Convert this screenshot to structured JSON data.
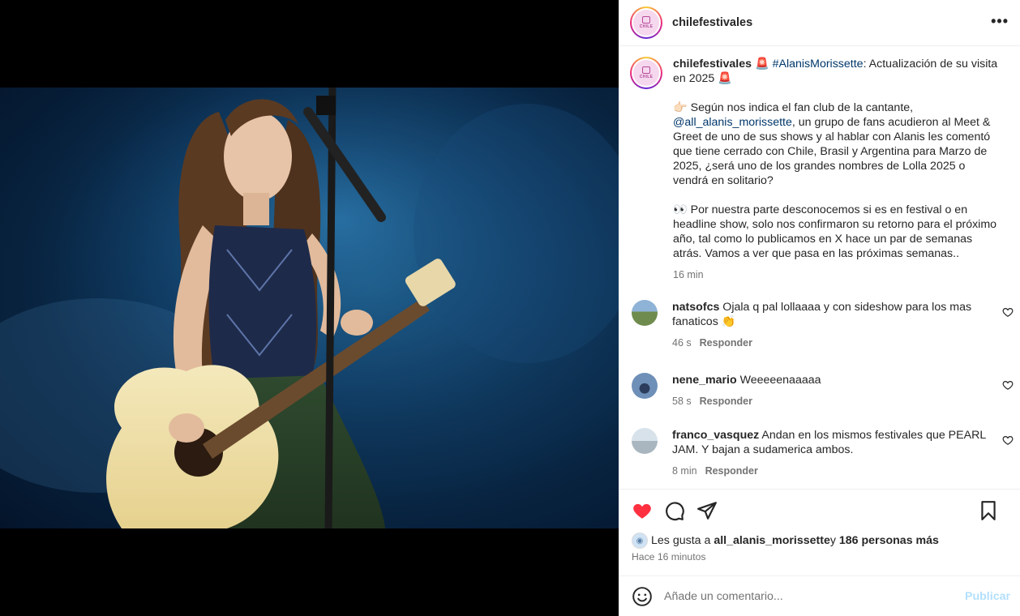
{
  "post": {
    "username": "chilefestivales",
    "logo_text": "CHILE",
    "caption": {
      "username": "chilefestivales",
      "line1_emoji": "🚨",
      "hashtag": "#AlanisMorissette",
      "line1_rest": ": Actualización de su visita en 2025 ",
      "line1_emoji_end": "🚨",
      "p2_emoji": "👉🏻",
      "p2_pre": " Según nos indica el fan club de la cantante, ",
      "p2_mention": "@all_alanis_morissette",
      "p2_post": ", un grupo de fans acudieron al Meet & Greet de uno de sus shows y al hablar con Alanis les comentó que tiene cerrado con Chile, Brasil y Argentina para Marzo de 2025, ¿será uno de los grandes nombres de Lolla 2025 o vendrá en solitario?",
      "p3_emoji": "👀",
      "p3_text": " Por nuestra parte desconocemos si es en festival o en headline show, solo nos confirmaron su retorno para el próximo año, tal como lo publicamos en X hace un par de semanas atrás. Vamos a ver que pasa en las próximas semanas..",
      "time": "16 min"
    },
    "comments": [
      {
        "username": "natsofcs",
        "text": " Ojala q pal lollaaaa y con sideshow para los mas fanaticos 👏",
        "time": "46 s",
        "reply": "Responder",
        "avatar_color": "#6f8c4e"
      },
      {
        "username": "nene_mario",
        "text": " Weeeeenaaaaa",
        "time": "58 s",
        "reply": "Responder",
        "avatar_color": "#6e8fb8"
      },
      {
        "username": "franco_vasquez",
        "text": " Andan en los mismos festivales que PEARL JAM. Y bajan a sudamerica ambos.",
        "time": "8 min",
        "reply": "Responder",
        "avatar_color": "#a9b6bf"
      }
    ],
    "likes": {
      "prefix": "Les gusta a ",
      "user": "all_alanis_morissette",
      "middle": " y ",
      "others": "186 personas más"
    },
    "ago": "Hace 16 minutos",
    "composer": {
      "placeholder": "Añade un comentario...",
      "publish": "Publicar"
    }
  },
  "colors": {
    "like_red": "#ff3040",
    "link": "#00376b",
    "muted": "#737373",
    "publish_disabled": "#b2dffc"
  },
  "icons": [
    "more-icon",
    "heart-icon",
    "comment-icon",
    "share-icon",
    "bookmark-icon",
    "emoji-icon",
    "heart-outline-icon"
  ]
}
